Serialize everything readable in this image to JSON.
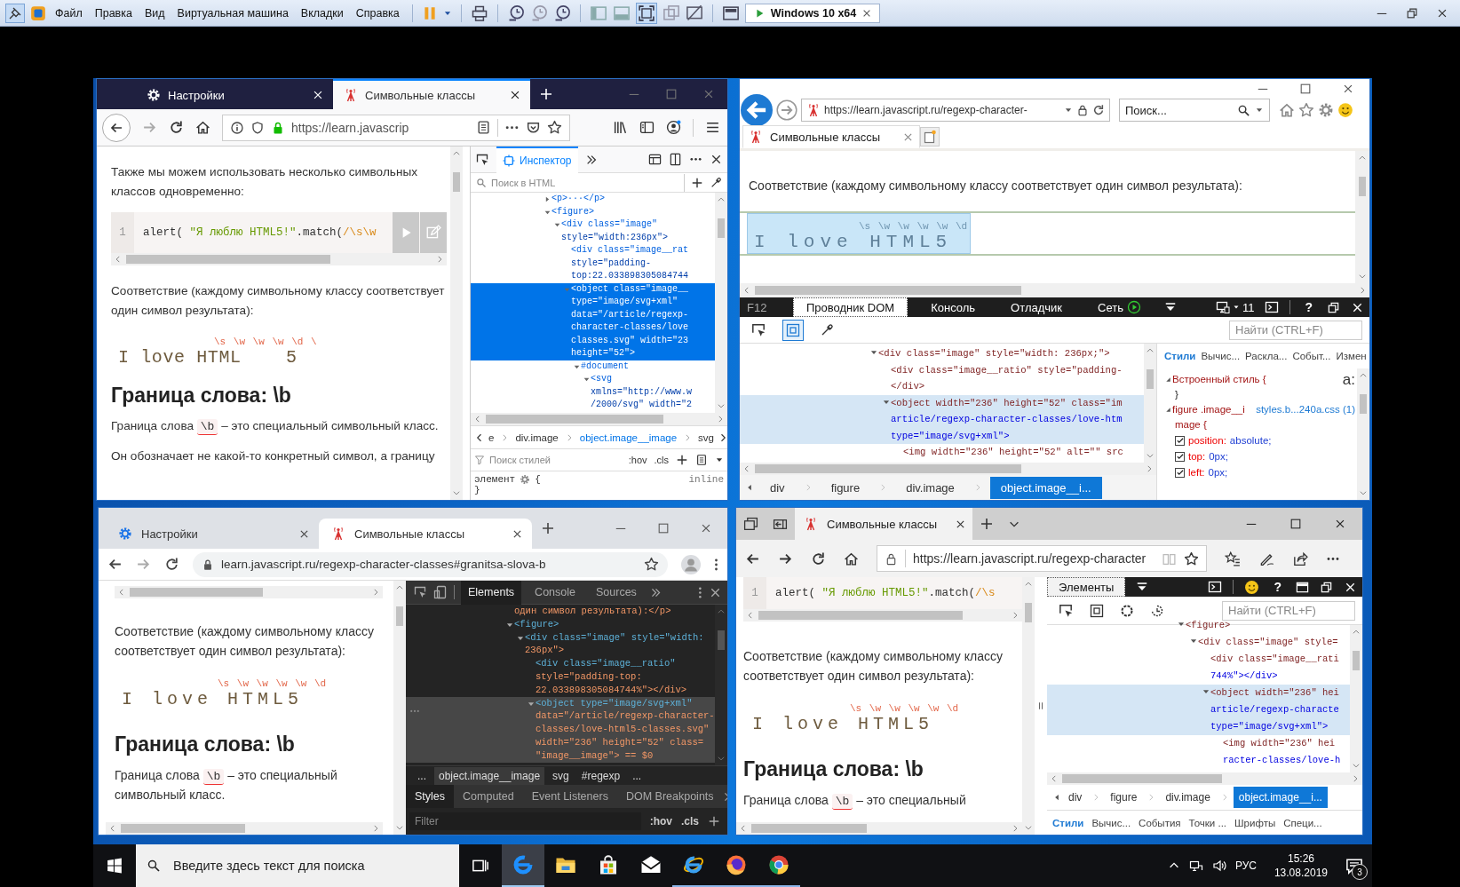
{
  "vm_toolbar": {
    "menu": [
      "Файл",
      "Правка",
      "Вид",
      "Виртуальная машина",
      "Вкладки",
      "Справка"
    ],
    "tab": {
      "label": "Windows 10 x64",
      "selected": true
    }
  },
  "windows": [
    {
      "kind": "firefox",
      "tabs": [
        {
          "label": "Настройки",
          "selected": false
        },
        {
          "label": "Символьные классы",
          "selected": true
        }
      ],
      "address": "https://learn.javascrip",
      "page": [
        {
          "kind": "paragraph",
          "text": "Также мы можем использовать несколько символьных классов одновременно:"
        },
        {
          "kind": "code",
          "line": "1",
          "code": "alert( \"Я люблю HTML5!\".match(/\\s\\w",
          "toolbar": true
        },
        {
          "kind": "paragraph",
          "text": "Соответствие (каждому символьному классу соответствует один символ результата):"
        },
        {
          "kind": "demo",
          "classes": "\\s \\w \\w \\w \\d \\",
          "text": "I love HTML    5",
          "highlighted": false
        },
        {
          "kind": "heading",
          "text": "Граница слова: \\b"
        },
        {
          "kind": "term",
          "before": "Граница слова",
          "code": "\\b",
          "after": "– это специальный символьный класс."
        },
        {
          "kind": "paragraph",
          "text": "Он обозначает не какой-то конкретный символ, а границу"
        }
      ],
      "devtools": {
        "tabs": [
          {
            "label": "Инспектор",
            "selected": true
          }
        ],
        "search": {
          "placeholder": "Поиск в HTML"
        },
        "dom_tree": [
          {
            "lines": [
              "<p>···</p>"
            ],
            "expanded": false,
            "selected": false
          },
          {
            "lines": [
              "<figure>"
            ],
            "expanded": true,
            "selected": false,
            "children": [
              {
                "lines": [
                  "<div class=\"image\"",
                  "style=\"width:236px\">"
                ],
                "expanded": true,
                "selected": false,
                "children": [
                  {
                    "lines": [
                      "<div class=\"image__rat",
                      "style=\"padding-",
                      "top:22.033898305084744"
                    ],
                    "selected": false
                  },
                  {
                    "lines": [
                      "<object class=\"image__",
                      "type=\"image/svg+xml\"",
                      "data=\"/article/regexp-",
                      "character-classes/love",
                      "classes.svg\" width=\"23",
                      "height=\"52\">"
                    ],
                    "expanded": true,
                    "selected": true,
                    "children": [
                      {
                        "lines": [
                          "#document"
                        ],
                        "expanded": true,
                        "selected": false,
                        "children": [
                          {
                            "lines": [
                              "<svg",
                              "xmlns=\"http://www.w",
                              "/2000/svg\" width=\"2"
                            ],
                            "expanded": true,
                            "selected": false
                          }
                        ]
                      }
                    ]
                  }
                ]
              }
            ]
          }
        ],
        "breadcrumbs": [
          {
            "label": "e",
            "selected": false
          },
          {
            "label": "div.image",
            "selected": false
          },
          {
            "label": "object.image__image",
            "selected": true
          },
          {
            "label": "svg",
            "selected": false
          }
        ],
        "styles_filter": {
          "placeholder": "Поиск стилей"
        },
        "style_buttons": [
          ":hov",
          ".cls"
        ],
        "element_rule": {
          "selector": "элемент",
          "open": "{",
          "source": "inline",
          "close": "}"
        }
      }
    },
    {
      "kind": "ie",
      "tabs": [
        {
          "label": "Символьные классы",
          "selected": true
        }
      ],
      "address": "https://learn.javascript.ru/regexp-character-",
      "search": {
        "placeholder": "Поиск..."
      },
      "page": [
        {
          "kind": "paragraph",
          "text": "Соответствие (каждому символьному классу соответствует один символ результата):"
        },
        {
          "kind": "demo",
          "classes": "\\s \\w \\w \\w \\w \\d",
          "text": "I love HTML5",
          "highlighted": true
        }
      ],
      "devtools": {
        "label": "F12",
        "tabs": [
          {
            "label": "Проводник DOM",
            "selected": true
          },
          {
            "label": "Консоль",
            "selected": false
          },
          {
            "label": "Отладчик",
            "selected": false
          },
          {
            "label": "Сеть",
            "selected": false
          }
        ],
        "emulation": "11",
        "help": "?",
        "find": {
          "placeholder": "Найти (CTRL+F)"
        },
        "dom_tree": [
          {
            "lines": [
              "<div class=\"image\" style=\"width: 236px;\">"
            ],
            "expanded": true,
            "selected": false,
            "children": [
              {
                "lines": [
                  "<div class=\"image__ratio\" style=\"padding-",
                  "</div>"
                ],
                "selected": false
              },
              {
                "lines": [
                  "<object width=\"236\" height=\"52\" class=\"im",
                  "article/regexp-character-classes/love-htm",
                  "type=\"image/svg+xml\">"
                ],
                "expanded": true,
                "selected": true,
                "children": [
                  {
                    "lines": [
                      "<img width=\"236\" height=\"52\" alt=\"\" src"
                    ],
                    "selected": false
                  }
                ]
              }
            ]
          }
        ],
        "breadcrumbs": [
          {
            "label": "div",
            "selected": false
          },
          {
            "label": "figure",
            "selected": false
          },
          {
            "label": "div.image",
            "selected": false
          },
          {
            "label": "object.image__i...",
            "selected": true
          }
        ],
        "style_tabs": [
          {
            "label": "Стили",
            "selected": true
          },
          {
            "label": "Вычис...",
            "selected": false
          },
          {
            "label": "Раскла...",
            "selected": false
          },
          {
            "label": "Событ...",
            "selected": false
          },
          {
            "label": "Измен",
            "selected": false
          }
        ],
        "styles": {
          "inline_rule": "Встроенный стиль {",
          "inline_close": "}",
          "font_toggle": "a:",
          "selector": "figure .image__i",
          "source": "styles.b...240a.css (1)",
          "selector_rest": "mage {",
          "properties": [
            {
              "name": "position:",
              "value": "absolute;",
              "checked": true
            },
            {
              "name": "top:",
              "value": "0px;",
              "checked": true
            },
            {
              "name": "left:",
              "value": "0px;",
              "checked": true
            }
          ]
        }
      }
    },
    {
      "kind": "chrome",
      "tabs": [
        {
          "label": "Настройки",
          "selected": false
        },
        {
          "label": "Символьные классы",
          "selected": true
        }
      ],
      "address": "learn.javascript.ru/regexp-character-classes#granitsa-slova-b",
      "page": [
        {
          "kind": "scrollbar"
        },
        {
          "kind": "paragraph",
          "text": "Соответствие (каждому символьному классу соответствует один символ результата):"
        },
        {
          "kind": "demo",
          "classes": "\\s \\w \\w \\w \\w \\d",
          "text": "I love HTML5",
          "highlighted": false
        },
        {
          "kind": "heading",
          "text": "Граница слова: \\b"
        },
        {
          "kind": "term",
          "before": "Граница слова",
          "code": "\\b",
          "after": "– это специальный символьный класс."
        }
      ],
      "devtools": {
        "tabs": [
          {
            "label": "Elements",
            "selected": true
          },
          {
            "label": "Console",
            "selected": false
          },
          {
            "label": "Sources",
            "selected": false
          }
        ],
        "dom_tree": [
          {
            "lines": [
              "один символ результата):</p>"
            ],
            "selected": false
          },
          {
            "lines": [
              "<figure>"
            ],
            "expanded": true,
            "selected": false,
            "children": [
              {
                "lines": [
                  "<div class=\"image\" style=\"width:",
                  "236px\">"
                ],
                "expanded": true,
                "selected": false,
                "children": [
                  {
                    "lines": [
                      "<div class=\"image__ratio\"",
                      "style=\"padding-top:",
                      "22.033898305084744%\"></div>"
                    ],
                    "selected": false
                  },
                  {
                    "lines": [
                      "<object type=\"image/svg+xml\"",
                      "data=\"/article/regexp-character-",
                      "classes/love-html5-classes.svg\"",
                      "width=\"236\" height=\"52\" class=",
                      "\"image__image\"> == $0"
                    ],
                    "expanded": true,
                    "selected": true
                  }
                ]
              }
            ]
          }
        ],
        "breadcrumbs": [
          {
            "label": "...",
            "selected": false
          },
          {
            "label": "object.image__image",
            "selected": true
          },
          {
            "label": "svg",
            "selected": false
          },
          {
            "label": "#regexp",
            "selected": false
          },
          {
            "label": "...",
            "selected": false
          }
        ],
        "style_tabs": [
          {
            "label": "Styles",
            "selected": true
          },
          {
            "label": "Computed",
            "selected": false
          },
          {
            "label": "Event Listeners",
            "selected": false
          },
          {
            "label": "DOM Breakpoints",
            "selected": false
          }
        ],
        "filter": {
          "placeholder": "Filter"
        },
        "style_buttons": [
          ":hov",
          ".cls"
        ]
      }
    },
    {
      "kind": "edge",
      "tabs": [
        {
          "label": "Символьные классы",
          "selected": true
        }
      ],
      "address": "https://learn.javascript.ru/regexp-character",
      "page": [
        {
          "kind": "code",
          "line": "1",
          "code": "alert( \"Я люблю HTML5!\".match(/\\s",
          "toolbar": false
        },
        {
          "kind": "paragraph",
          "text": "Соответствие (каждому символьному классу соответствует один символ результата):"
        },
        {
          "kind": "demo",
          "classes": "\\s \\w \\w \\w \\w \\d",
          "text": "I love HTML5",
          "highlighted": false
        },
        {
          "kind": "heading",
          "text": "Граница слова: \\b"
        },
        {
          "kind": "term",
          "before": "Граница слова",
          "code": "\\b",
          "after": "– это специальный"
        }
      ],
      "devtools": {
        "tabs": [
          {
            "label": "Элементы",
            "selected": true
          }
        ],
        "help": "?",
        "find": {
          "placeholder": "Найти (CTRL+F)"
        },
        "dom_tree": [
          {
            "lines": [
              "<figure>"
            ],
            "expanded": true,
            "selected": false,
            "children": [
              {
                "lines": [
                  "<div class=\"image\" style="
                ],
                "expanded": true,
                "selected": false,
                "children": [
                  {
                    "lines": [
                      "<div class=\"image__rati",
                      "744%\"></div>"
                    ],
                    "selected": false
                  },
                  {
                    "lines": [
                      "<object width=\"236\" hei",
                      "article/regexp-characte",
                      "type=\"image/svg+xml\">"
                    ],
                    "expanded": true,
                    "selected": true,
                    "children": [
                      {
                        "lines": [
                          "<img width=\"236\" hei",
                          "racter-classes/love-h"
                        ],
                        "selected": false
                      }
                    ]
                  }
                ]
              }
            ]
          }
        ],
        "breadcrumbs": [
          {
            "label": "div",
            "selected": false
          },
          {
            "label": "figure",
            "selected": false
          },
          {
            "label": "div.image",
            "selected": false
          },
          {
            "label": "object.image__i...",
            "selected": true
          }
        ],
        "style_tabs": [
          {
            "label": "Стили",
            "selected": true
          },
          {
            "label": "Вычис...",
            "selected": false
          },
          {
            "label": "События",
            "selected": false
          },
          {
            "label": "Точки ...",
            "selected": false
          },
          {
            "label": "Шрифты",
            "selected": false
          },
          {
            "label": "Специ...",
            "selected": false
          }
        ]
      }
    }
  ],
  "taskbar": {
    "search": {
      "placeholder": "Введите здесь текст для поиска"
    },
    "apps": [
      {
        "kind": "edge",
        "selected": true,
        "running": true
      },
      {
        "kind": "explorer",
        "selected": false,
        "running": false
      },
      {
        "kind": "store",
        "selected": false,
        "running": false
      },
      {
        "kind": "mail",
        "selected": false,
        "running": false
      },
      {
        "kind": "ie",
        "selected": false,
        "running": true
      },
      {
        "kind": "firefox",
        "selected": false,
        "running": true
      },
      {
        "kind": "chrome",
        "selected": false,
        "running": true
      }
    ],
    "language": "РУС",
    "time": "15:26",
    "date": "13.08.2019",
    "notifications": "3"
  }
}
